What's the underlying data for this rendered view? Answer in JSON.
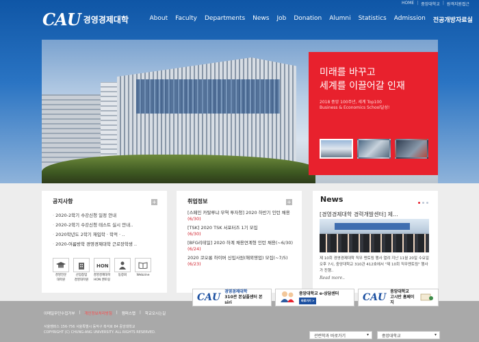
{
  "top_links": [
    "HOME",
    "중앙대학교",
    "원격지원접근"
  ],
  "logo": {
    "mark": "CAU",
    "name": "경영경제대학"
  },
  "nav": [
    "About",
    "Faculty",
    "Departments",
    "News",
    "Job",
    "Donation",
    "Alumni",
    "Statistics",
    "Admission",
    "전공개방자료실"
  ],
  "hero": {
    "line1": "미래를 바꾸고",
    "line2": "세계를 이끌어갈 인재",
    "sub1": "2018 중앙 100주년, 세계 Top100",
    "sub2": "Business & Economics School달성!"
  },
  "notice": {
    "title": "공지사항",
    "items": [
      "2020-2학기 수강신청 일정 안내",
      "2020-2학기 수강신청 테스트 실시 안내..",
      "2020학년도 2학기 재입학 · 학적 · ..",
      "2020-여름방학 경영경제대학 근로장학생 .."
    ],
    "icons": [
      {
        "name": "graduation-cap-icon",
        "caption1": "경영전문",
        "caption2": "대학원"
      },
      {
        "name": "building-icon",
        "caption1": "산업창업",
        "caption2": "경영대학원"
      },
      {
        "name": "hon-icon",
        "caption1": "경영경제대학",
        "caption2": "HON 멘토링"
      },
      {
        "name": "person-icon",
        "caption1": "동창회",
        "caption2": ""
      },
      {
        "name": "book-icon",
        "caption1": "Webzine",
        "caption2": ""
      }
    ]
  },
  "jobs": {
    "title": "취업정보",
    "items": [
      {
        "text": "[스페인 카탈루냐 무역 투자청] 2020 하반기 인턴 채용",
        "date": "(6/30)"
      },
      {
        "text": "[TSK] 2020 TSK 서포터즈 1기 모집",
        "date": "(6/30)"
      },
      {
        "text": "[BFG리테일] 2020 하계 채용연계형 인턴 채용(~6/30)",
        "date": "(6/24)"
      },
      {
        "text": "2020 코오롱 하이버 신입사원(해외영업) 모집(~7/5)",
        "date": "(6/23)"
      }
    ]
  },
  "news": {
    "title": "News",
    "headline": "[경영경제대학 경력개발센터] 제...",
    "photo_banner": "제 10회 직무멘토링",
    "body": "제 10회 경영경제대학 직무 멘토링 행사 열려   지난 11월 20일 수요일 오후 7시, 중앙대학교 310관 412호에서 \"제 10회 직무멘토링\" 행사가 진행..",
    "more": "Read more.."
  },
  "footer": {
    "links": [
      "이메일무단수집거부",
      "개인정보처리방침",
      "캠퍼스맵",
      "학교오시는길"
    ],
    "address1": "서울캠퍼스   156-756 서울특별시 동작구 흑석로 84 중앙대학교",
    "address2": "COPYRIGHT (C) CHUNG-ANG UNIVERSITY.  ALL RIGHTS RESERVED."
  },
  "banners": [
    {
      "logo": "CAU",
      "line1": "경영경제대학",
      "line2": "310관 본실플센터 본siri"
    },
    {
      "line1": "중앙대학교 e-상담센터",
      "tag": "바로가기 >"
    },
    {
      "logo": "CAU",
      "line1": "중앙대학교",
      "line2": "고시반 홈페이지"
    }
  ],
  "selects": [
    "관련학과 바로가기",
    "중앙대학교"
  ],
  "colors": {
    "brand_blue": "#1b4fa0",
    "accent_red": "#e8212d"
  }
}
